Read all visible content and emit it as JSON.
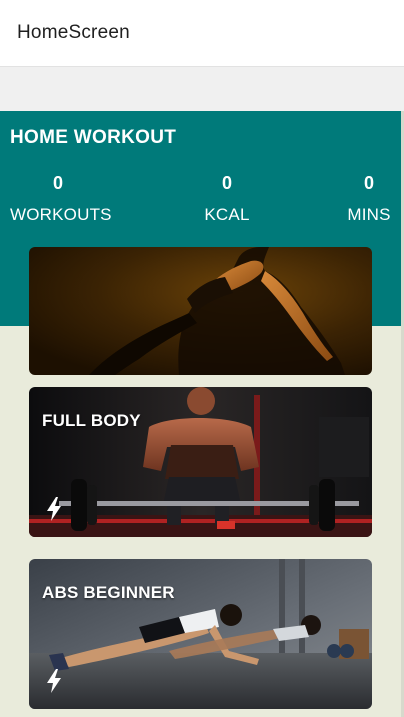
{
  "app_bar": {
    "title": "HomeScreen"
  },
  "summary": {
    "title": "HOME WORKOUT",
    "stats": [
      {
        "value": "0",
        "label": "WORKOUTS"
      },
      {
        "value": "0",
        "label": "KCAL"
      },
      {
        "value": "0",
        "label": "MINS"
      }
    ]
  },
  "workouts": [
    {
      "title": "FULL BODY",
      "icon": "lightning-bolt-icon"
    },
    {
      "title": "ABS BEGINNER",
      "icon": "lightning-bolt-icon"
    }
  ],
  "colors": {
    "panel": "#007a7a",
    "background": "#e9ebdb",
    "text_on_panel": "#ffffff"
  }
}
